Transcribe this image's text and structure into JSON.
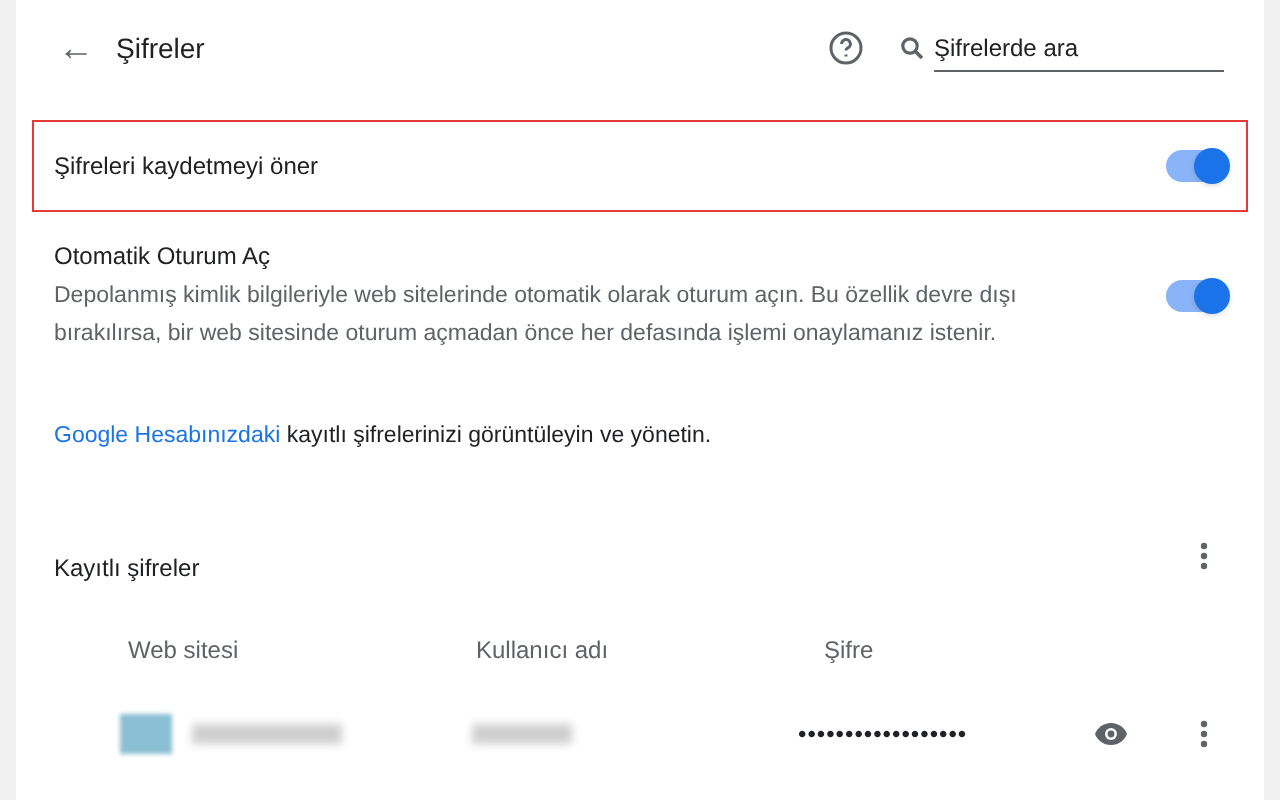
{
  "header": {
    "back": "←",
    "title": "Şifreler",
    "search": {
      "placeholder": "Şifrelerde ara"
    }
  },
  "settings": [
    {
      "kind": "toggle",
      "label": "Şifreleri kaydetmeyi öner",
      "on": true,
      "highlighted": true
    },
    {
      "kind": "toggle",
      "label": "Otomatik Oturum Aç",
      "description": "Depolanmış kimlik bilgileriyle web sitelerinde otomatik olarak oturum açın. Bu özellik devre dışı bırakılırsa, bir web sitesinde oturum açmadan önce her defasında işlemi onaylamanız istenir.",
      "on": true,
      "highlighted": false
    }
  ],
  "account_link": {
    "link": "Google Hesabınızdaki",
    "text": "kayıtlı şifrelerinizi görüntüleyin ve yönetin."
  },
  "saved": {
    "title": "Kayıtlı şifreler",
    "columns": [
      "Web sitesi",
      "Kullanıcı adı",
      "Şifre"
    ],
    "rows": [
      {
        "password": "••••••••••••••••••"
      }
    ]
  }
}
